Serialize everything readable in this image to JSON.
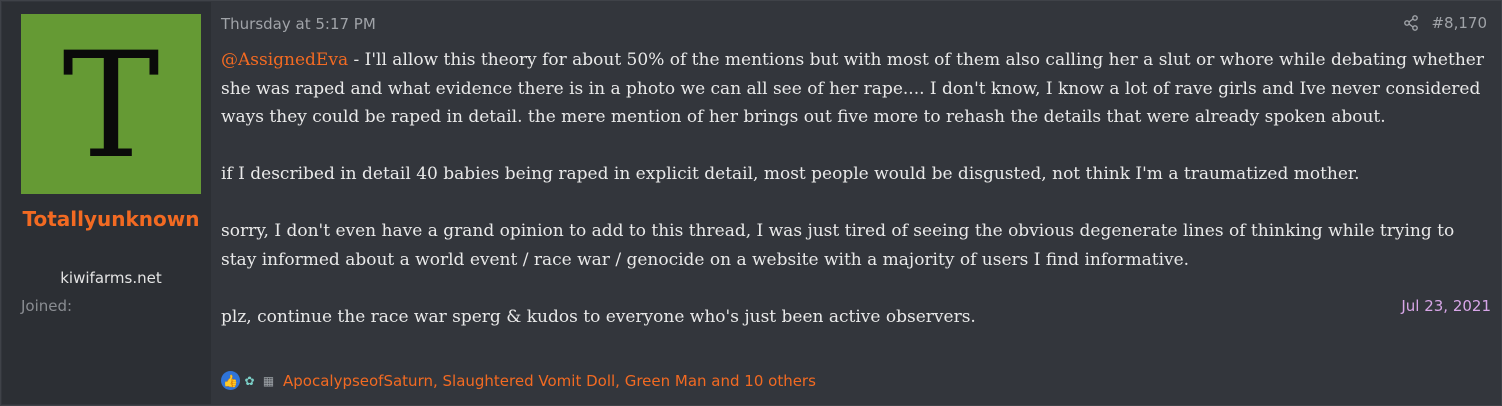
{
  "user": {
    "avatar_letter": "T",
    "avatar_color": "#659a34",
    "username": "Totallyunknown",
    "title": "kiwifarms.net",
    "joined_label": "Joined:",
    "joined_date": "Jul 23, 2021"
  },
  "post": {
    "date": "Thursday at 5:17 PM",
    "share_icon": "share-icon",
    "number": "#8,170",
    "mention": "@AssignedEva",
    "paragraphs": [
      " - I'll allow this theory for about 50% of the mentions but with most of them also calling her a slut or whore while debating whether she was raped and what evidence there is in a photo we can all see of her rape.... I don't know, I know a lot of rave girls and Ive never considered ways they could be raped in detail. the mere mention of her brings out five more to rehash the details that were already spoken about.",
      "if I described in detail 40 babies being raped in explicit detail, most people would be disgusted, not think I'm a traumatized mother.",
      "sorry, I don't even have a grand opinion to add to this thread, I was just tired of seeing the obvious degenerate lines of thinking while trying to stay informed about a world event / race war / genocide on a website with a majority of users I find informative.",
      "plz, continue the race war sperg & kudos to everyone who's just been active observers."
    ]
  },
  "reactions": {
    "icons": [
      "like-icon",
      "flower-icon",
      "book-icon"
    ],
    "users_text": "ApocalypseofSaturn, Slaughtered Vomit Doll, Green Man and 10 others"
  },
  "colors": {
    "accent": "#f26a22",
    "background": "#33363c",
    "sidebar": "#2c2f34",
    "joined_date": "#d8a6e8"
  }
}
